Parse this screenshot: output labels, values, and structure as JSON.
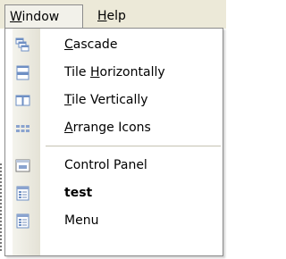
{
  "menubar": {
    "window": {
      "label_pre": "",
      "label_hot": "W",
      "label_post": "indow"
    },
    "help": {
      "label_pre": "",
      "label_hot": "H",
      "label_post": "elp"
    }
  },
  "menu": {
    "items": [
      {
        "pre": "",
        "hot": "C",
        "post": "ascade",
        "icon": "cascade-icon",
        "bold": false
      },
      {
        "pre": "Tile ",
        "hot": "H",
        "post": "orizontally",
        "icon": "tile-horizontally-icon",
        "bold": false
      },
      {
        "pre": "",
        "hot": "T",
        "post": "ile Vertically",
        "icon": "tile-vertically-icon",
        "bold": false
      },
      {
        "pre": "",
        "hot": "A",
        "post": "rrange Icons",
        "icon": "arrange-icons-icon",
        "bold": false
      },
      {
        "pre": "Control Panel",
        "hot": "",
        "post": "",
        "icon": "control-panel-icon",
        "bold": false
      },
      {
        "pre": "test",
        "hot": "",
        "post": "",
        "icon": "window-doc-icon",
        "bold": true
      },
      {
        "pre": "Menu",
        "hot": "",
        "post": "",
        "icon": "window-doc-icon",
        "bold": false
      }
    ]
  },
  "colors": {
    "menubar_bg": "#ece9d8",
    "gutter_light": "#f8f8f3",
    "gutter_dark": "#e4e2d6",
    "border": "#8b8b8b",
    "icon_blue": "#7b96c7"
  }
}
